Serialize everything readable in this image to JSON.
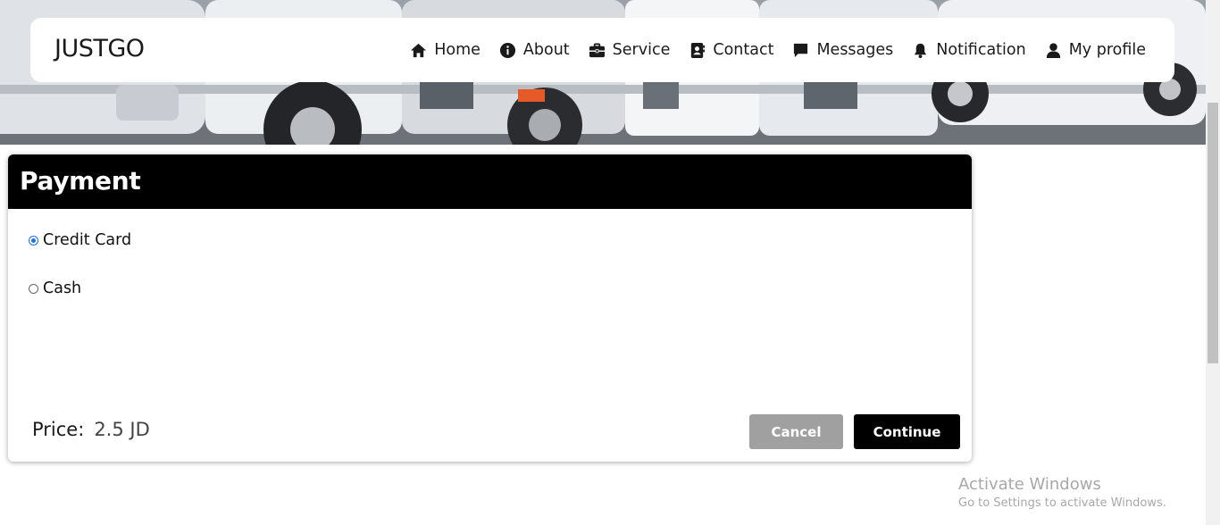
{
  "brand": "JUSTGO",
  "nav": [
    {
      "label": "Home",
      "icon": "home-icon"
    },
    {
      "label": "About",
      "icon": "info-icon"
    },
    {
      "label": "Service",
      "icon": "briefcase-icon"
    },
    {
      "label": "Contact",
      "icon": "contact-card-icon"
    },
    {
      "label": "Messages",
      "icon": "message-icon"
    },
    {
      "label": "Notification",
      "icon": "bell-icon"
    },
    {
      "label": "My profile",
      "icon": "user-icon"
    }
  ],
  "payment": {
    "title": "Payment",
    "options": [
      {
        "label": "Credit Card",
        "checked": true
      },
      {
        "label": "Cash",
        "checked": false
      }
    ],
    "price_label": "Price:",
    "price_value": "2.5 JD",
    "cancel_label": "Cancel",
    "continue_label": "Continue"
  },
  "watermark": {
    "title": "Activate Windows",
    "subtitle": "Go to Settings to activate Windows."
  },
  "colors": {
    "header_bg": "#000000",
    "cancel_bg": "#a0a0a0",
    "continue_bg": "#000000",
    "radio_accent": "#1a73e8"
  }
}
